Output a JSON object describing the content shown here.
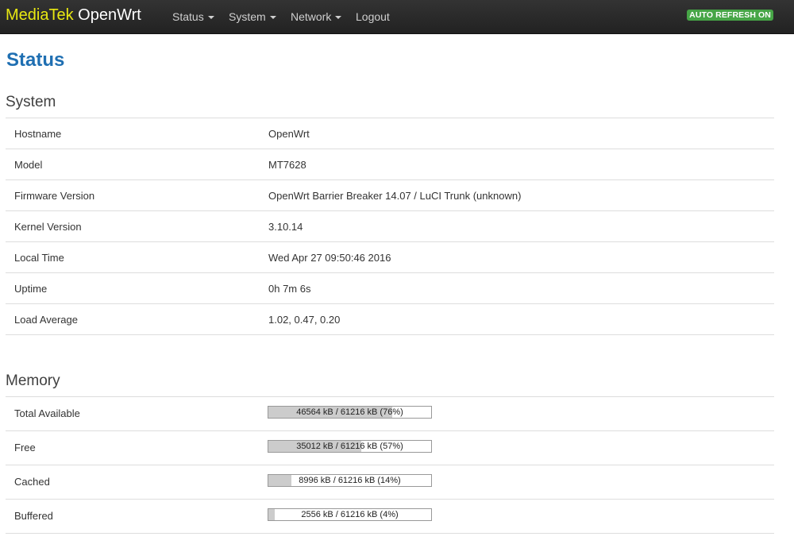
{
  "brand": {
    "part1": "MediaTek",
    "part2": "OpenWrt"
  },
  "nav": [
    {
      "label": "Status",
      "dropdown": true
    },
    {
      "label": "System",
      "dropdown": true
    },
    {
      "label": "Network",
      "dropdown": true
    },
    {
      "label": "Logout",
      "dropdown": false
    }
  ],
  "auto_refresh": "AUTO REFRESH ON",
  "page_title": "Status",
  "system": {
    "heading": "System",
    "rows": [
      {
        "label": "Hostname",
        "value": "OpenWrt"
      },
      {
        "label": "Model",
        "value": "MT7628"
      },
      {
        "label": "Firmware Version",
        "value": "OpenWrt Barrier Breaker 14.07 / LuCI Trunk (unknown)"
      },
      {
        "label": "Kernel Version",
        "value": "3.10.14"
      },
      {
        "label": "Local Time",
        "value": "Wed Apr 27 09:50:46 2016"
      },
      {
        "label": "Uptime",
        "value": "0h 7m 6s"
      },
      {
        "label": "Load Average",
        "value": "1.02, 0.47, 0.20"
      }
    ]
  },
  "memory": {
    "heading": "Memory",
    "rows": [
      {
        "label": "Total Available",
        "text": "46564 kB / 61216 kB (76%)",
        "percent": 76
      },
      {
        "label": "Free",
        "text": "35012 kB / 61216 kB (57%)",
        "percent": 57
      },
      {
        "label": "Cached",
        "text": "8996 kB / 61216 kB (14%)",
        "percent": 14
      },
      {
        "label": "Buffered",
        "text": "2556 kB / 61216 kB (4%)",
        "percent": 4
      }
    ]
  },
  "colors": {
    "navbar": "#222222",
    "brand_accent": "#e8e812",
    "title": "#1f6fb2",
    "badge": "#46a546"
  }
}
